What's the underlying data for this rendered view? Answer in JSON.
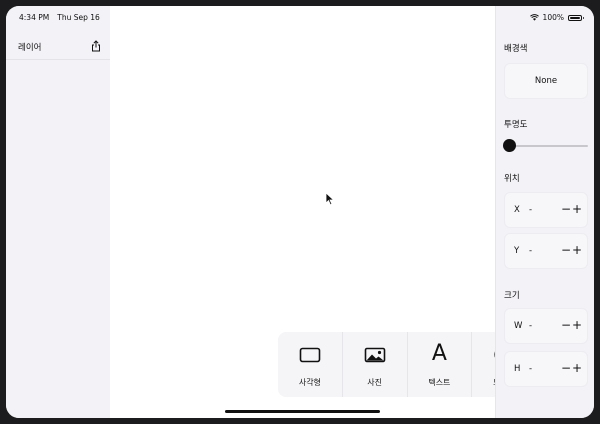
{
  "status_bar": {
    "time": "4:34 PM",
    "date": "Thu Sep 16",
    "battery": "100%",
    "battery_level": 1.0
  },
  "layers_panel": {
    "title": "레이어",
    "share_icon": "share-icon"
  },
  "properties": {
    "background": {
      "label": "배경색",
      "value": "None"
    },
    "opacity": {
      "label": "투명도",
      "level": 0.0
    },
    "position": {
      "label": "위치",
      "x_label": "X",
      "x_value": "-",
      "y_label": "Y",
      "y_value": "-"
    },
    "size": {
      "label": "크기",
      "w_label": "W",
      "w_value": "-",
      "h_label": "H",
      "h_value": "-"
    },
    "minus": "−",
    "plus": "+"
  },
  "toolbar": {
    "items": [
      {
        "label": "사각형",
        "icon": "rectangle-icon"
      },
      {
        "label": "사진",
        "icon": "photo-icon"
      },
      {
        "label": "텍스트",
        "icon": "text-icon"
      },
      {
        "label": "드로잉",
        "icon": "drawing-icon"
      }
    ],
    "text_glyph": "A"
  }
}
